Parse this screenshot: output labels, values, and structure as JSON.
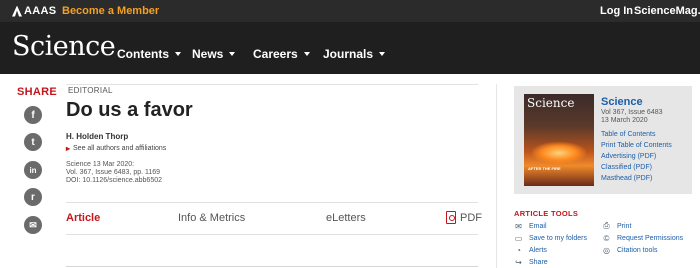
{
  "topbar": {
    "org_logo": "AAAS",
    "become_member": "Become a Member",
    "login": "Log In",
    "site_link": "ScienceMag.org"
  },
  "header": {
    "logo": "Science",
    "nav": [
      {
        "label": "Contents"
      },
      {
        "label": "News"
      },
      {
        "label": "Careers"
      },
      {
        "label": "Journals"
      }
    ]
  },
  "share": {
    "title": "SHARE",
    "icons": [
      "facebook-icon",
      "twitter-icon",
      "linkedin-icon",
      "reddit-icon",
      "email-icon"
    ],
    "glyphs": [
      "f",
      "t",
      "in",
      "r",
      "✉"
    ]
  },
  "article": {
    "section": "EDITORIAL",
    "title": "Do us a favor",
    "author": "H. Holden Thorp",
    "affiliations": "See all authors and affiliations",
    "meta": [
      "Science  13 Mar 2020:",
      "Vol. 367, Issue 6483, pp. 1169",
      "DOI: 10.1126/science.abb6502"
    ],
    "tabs": [
      {
        "label": "Article",
        "active": true
      },
      {
        "label": "Info & Metrics",
        "active": false
      },
      {
        "label": "eLetters",
        "active": false
      },
      {
        "label": "PDF",
        "active": false
      }
    ]
  },
  "sidebar": {
    "cover": {
      "masthead": "Science",
      "caption": "AFTER THE FIRE"
    },
    "magazine": "Science",
    "issue_meta": [
      "Vol 367, Issue 6483",
      "13 March 2020"
    ],
    "links": [
      "Table of Contents",
      "Print Table of Contents",
      "Advertising (PDF)",
      "Classified (PDF)",
      "Masthead (PDF)"
    ],
    "tools_title": "ARTICLE TOOLS",
    "tools_left": [
      {
        "label": "Email",
        "icon": "email-icon",
        "glyph": "✉"
      },
      {
        "label": "Save to my folders",
        "icon": "folder-icon",
        "glyph": "▭"
      },
      {
        "label": "Alerts",
        "icon": "bell-icon",
        "glyph": "◔"
      },
      {
        "label": "Share",
        "icon": "share-icon",
        "glyph": "↪"
      }
    ],
    "tools_right": [
      {
        "label": "Print",
        "icon": "printer-icon",
        "glyph": "⎙"
      },
      {
        "label": "Request Permissions",
        "icon": "copyright-icon",
        "glyph": "©"
      },
      {
        "label": "Citation tools",
        "icon": "citation-icon",
        "glyph": "◎"
      }
    ]
  },
  "colors": {
    "accent_red": "#c4161c",
    "link_blue": "#1c5fa8",
    "member_orange": "#f4a023"
  }
}
